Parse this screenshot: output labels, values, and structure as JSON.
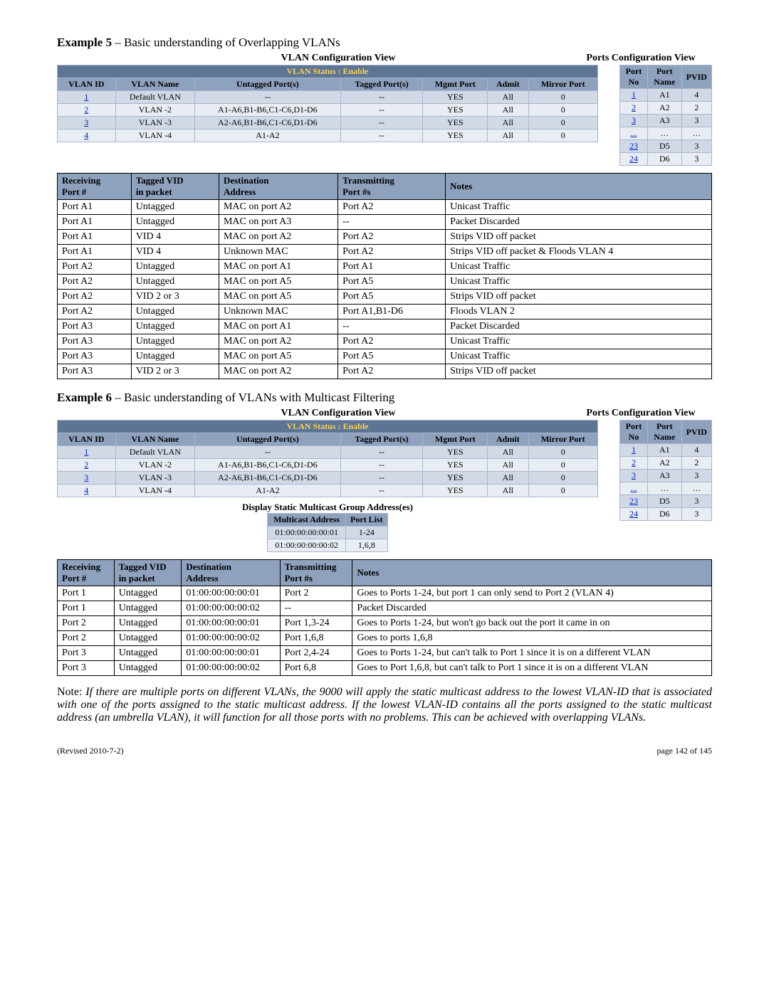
{
  "example5": {
    "heading_bold": "Example 5",
    "heading_rest": " – Basic understanding of Overlapping VLANs",
    "left_title": "VLAN Configuration View",
    "right_title": "Ports Configuration View",
    "vlan_status_label": "VLAN Status   :   Enable",
    "vlan_headers": [
      "VLAN ID",
      "VLAN Name",
      "Untagged Port(s)",
      "Tagged Port(s)",
      "Mgmt Port",
      "Admit",
      "Mirror Port"
    ],
    "vlan_rows": [
      {
        "id": "1",
        "name": "Default VLAN",
        "untagged": "--",
        "tagged": "--",
        "mgmt": "YES",
        "admit": "All",
        "mirror": "0"
      },
      {
        "id": "2",
        "name": "VLAN -2",
        "untagged": "A1-A6,B1-B6,C1-C6,D1-D6",
        "tagged": "--",
        "mgmt": "YES",
        "admit": "All",
        "mirror": "0"
      },
      {
        "id": "3",
        "name": "VLAN -3",
        "untagged": "A2-A6,B1-B6,C1-C6,D1-D6",
        "tagged": "--",
        "mgmt": "YES",
        "admit": "All",
        "mirror": "0"
      },
      {
        "id": "4",
        "name": "VLAN -4",
        "untagged": "A1-A2",
        "tagged": "--",
        "mgmt": "YES",
        "admit": "All",
        "mirror": "0"
      }
    ],
    "ports_headers": [
      "Port No",
      "Port Name",
      "PVID"
    ],
    "ports_rows": [
      {
        "no": "1",
        "name": "A1",
        "pvid": "4"
      },
      {
        "no": "2",
        "name": "A2",
        "pvid": "2"
      },
      {
        "no": "3",
        "name": "A3",
        "pvid": "3"
      },
      {
        "no": "...",
        "name": "…",
        "pvid": "…"
      },
      {
        "no": "23",
        "name": "D5",
        "pvid": "3"
      },
      {
        "no": "24",
        "name": "D6",
        "pvid": "3"
      }
    ],
    "traffic_headers": [
      "Receiving Port #",
      "Tagged VID in packet",
      "Destination Address",
      "Transmitting Port #s",
      "Notes"
    ],
    "traffic_rows": [
      [
        "Port A1",
        "Untagged",
        "MAC on port A2",
        "Port A2",
        "Unicast Traffic"
      ],
      [
        "Port A1",
        "Untagged",
        "MAC on port A3",
        "--",
        "Packet Discarded"
      ],
      [
        "Port A1",
        "VID 4",
        "MAC on port A2",
        "Port A2",
        "Strips VID off packet"
      ],
      [
        "Port A1",
        "VID 4",
        "Unknown MAC",
        "Port A2",
        "Strips VID off packet & Floods VLAN 4"
      ],
      [
        "Port A2",
        "Untagged",
        "MAC on port A1",
        "Port A1",
        "Unicast Traffic"
      ],
      [
        "Port A2",
        "Untagged",
        "MAC on port A5",
        "Port A5",
        "Unicast Traffic"
      ],
      [
        "Port A2",
        "VID 2 or 3",
        "MAC on port A5",
        "Port A5",
        "Strips VID off packet"
      ],
      [
        "Port A2",
        "Untagged",
        "Unknown MAC",
        "Port A1,B1-D6",
        "Floods VLAN 2"
      ],
      [
        "Port A3",
        "Untagged",
        "MAC on port A1",
        "--",
        "Packet Discarded"
      ],
      [
        "Port A3",
        "Untagged",
        "MAC on port A2",
        "Port A2",
        "Unicast Traffic"
      ],
      [
        "Port A3",
        "Untagged",
        "MAC on port A5",
        "Port A5",
        "Unicast Traffic"
      ],
      [
        "Port A3",
        "VID 2 or 3",
        "MAC on port A2",
        "Port A2",
        "Strips VID off packet"
      ]
    ]
  },
  "example6": {
    "heading_bold": "Example 6",
    "heading_rest": " – Basic understanding of VLANs with Multicast Filtering",
    "left_title": "VLAN Configuration View",
    "right_title": "Ports Configuration View",
    "vlan_status_label": "VLAN Status   :   Enable",
    "vlan_headers": [
      "VLAN ID",
      "VLAN Name",
      "Untagged Port(s)",
      "Tagged Port(s)",
      "Mgmt Port",
      "Admit",
      "Mirror Port"
    ],
    "vlan_rows": [
      {
        "id": "1",
        "name": "Default VLAN",
        "untagged": "--",
        "tagged": "--",
        "mgmt": "YES",
        "admit": "All",
        "mirror": "0"
      },
      {
        "id": "2",
        "name": "VLAN -2",
        "untagged": "A1-A6,B1-B6,C1-C6,D1-D6",
        "tagged": "--",
        "mgmt": "YES",
        "admit": "All",
        "mirror": "0"
      },
      {
        "id": "3",
        "name": "VLAN -3",
        "untagged": "A2-A6,B1-B6,C1-C6,D1-D6",
        "tagged": "--",
        "mgmt": "YES",
        "admit": "All",
        "mirror": "0"
      },
      {
        "id": "4",
        "name": "VLAN -4",
        "untagged": "A1-A2",
        "tagged": "--",
        "mgmt": "YES",
        "admit": "All",
        "mirror": "0"
      }
    ],
    "ports_headers": [
      "Port No",
      "Port Name",
      "PVID"
    ],
    "ports_rows": [
      {
        "no": "1",
        "name": "A1",
        "pvid": "4"
      },
      {
        "no": "2",
        "name": "A2",
        "pvid": "2"
      },
      {
        "no": "3",
        "name": "A3",
        "pvid": "3"
      },
      {
        "no": "...",
        "name": "…",
        "pvid": "…"
      },
      {
        "no": "23",
        "name": "D5",
        "pvid": "3"
      },
      {
        "no": "24",
        "name": "D6",
        "pvid": "3"
      }
    ],
    "mc_title": "Display Static Multicast Group Address(es)",
    "mc_headers": [
      "Multicast Address",
      "Port List"
    ],
    "mc_rows": [
      [
        "01:00:00:00:00:01",
        "1-24"
      ],
      [
        "01:00:00:00:00:02",
        "1,6,8"
      ]
    ],
    "traffic_headers": [
      "Receiving Port #",
      "Tagged VID in packet",
      "Destination Address",
      "Transmitting Port #s",
      "Notes"
    ],
    "traffic_rows": [
      [
        "Port 1",
        "Untagged",
        "01:00:00:00:00:01",
        "Port 2",
        "Goes to Ports 1-24, but port 1 can only send to Port 2 (VLAN 4)"
      ],
      [
        "Port 1",
        "Untagged",
        "01:00:00:00:00:02",
        "--",
        "Packet Discarded"
      ],
      [
        "Port 2",
        "Untagged",
        "01:00:00:00:00:01",
        "Port 1,3-24",
        "Goes to Ports 1-24, but won't go back out the port it came in on"
      ],
      [
        "Port 2",
        "Untagged",
        "01:00:00:00:00:02",
        "Port 1,6,8",
        "Goes to ports 1,6,8"
      ],
      [
        "Port 3",
        "Untagged",
        "01:00:00:00:00:01",
        "Port 2,4-24",
        "Goes to Ports 1-24, but can't talk to Port 1 since it is on a different VLAN"
      ],
      [
        "Port 3",
        "Untagged",
        "01:00:00:00:00:02",
        "Port 6,8",
        "Goes to Port 1,6,8, but can't talk to Port 1 since it is on a different VLAN"
      ]
    ]
  },
  "note": {
    "label": "Note: ",
    "body": "If there are multiple ports on different VLANs, the 9000 will apply the static multicast address to the lowest VLAN-ID that is associated with one of the ports assigned to the static multicast address.  If the lowest VLAN-ID contains all the ports assigned to the static multicast address (an umbrella VLAN), it will function for all those ports with no problems.  This can be achieved with overlapping VLANs."
  },
  "footer": {
    "left": "(Revised 2010-7-2)",
    "right": "page 142 of 145"
  }
}
